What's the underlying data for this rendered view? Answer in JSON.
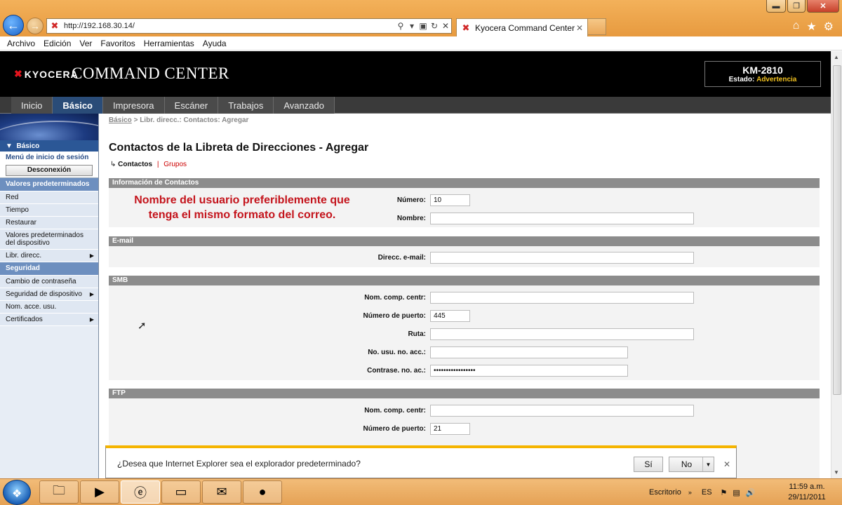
{
  "browser": {
    "url": "http://192.168.30.14/",
    "tab_title": "Kyocera Command Center",
    "menu": [
      "Archivo",
      "Edición",
      "Ver",
      "Favoritos",
      "Herramientas",
      "Ayuda"
    ]
  },
  "header": {
    "brand": "KYOCERA",
    "title": "COMMAND CENTER",
    "model": "KM-2810",
    "status_label": "Estado:",
    "status_value": "Advertencia"
  },
  "nav": [
    "Inicio",
    "Básico",
    "Impresora",
    "Escáner",
    "Trabajos",
    "Avanzado"
  ],
  "sidebar": {
    "basic": "Básico",
    "session_menu": "Menú de inicio de sesión",
    "logout": "Desconexión",
    "items": [
      {
        "label": "Valores predeterminados",
        "type": "section"
      },
      {
        "label": "Red",
        "type": "item"
      },
      {
        "label": "Tiempo",
        "type": "item"
      },
      {
        "label": "Restaurar",
        "type": "item"
      },
      {
        "label": "Valores predeterminados del dispositivo",
        "type": "item"
      },
      {
        "label": "Libr. direcc.",
        "type": "item",
        "arrow": true
      },
      {
        "label": "Seguridad",
        "type": "section"
      },
      {
        "label": "Cambio de contraseña",
        "type": "item"
      },
      {
        "label": "Seguridad de dispositivo",
        "type": "item",
        "arrow": true
      },
      {
        "label": "Nom. acce. usu.",
        "type": "item"
      },
      {
        "label": "Certificados",
        "type": "item",
        "arrow": true
      }
    ]
  },
  "breadcrumb": {
    "link": "Básico",
    "sep": ">",
    "current": "Libr. direcc.: Contactos: Agregar"
  },
  "page": {
    "title": "Contactos de la Libreta de Direcciones - Agregar",
    "subnav_current": "Contactos",
    "subnav_sep": "|",
    "subnav_other": "Grupos",
    "note": "Nombre del usuario preferiblemente que tenga el mismo formato del correo."
  },
  "form": {
    "contact_section": "Información de Contactos",
    "number_label": "Número:",
    "number_value": "10",
    "name_label": "Nombre:",
    "name_value": "",
    "email_section": "E-mail",
    "email_label": "Direcc. e-mail:",
    "email_value": "",
    "smb_section": "SMB",
    "smb_host_label": "Nom. comp. centr:",
    "smb_host_value": "",
    "smb_port_label": "Número de puerto:",
    "smb_port_value": "445",
    "smb_path_label": "Ruta:",
    "smb_path_value": "",
    "smb_user_label": "No. usu. no. acc.:",
    "smb_user_value": "",
    "smb_pass_label": "Contrase. no. ac.:",
    "smb_pass_value": "•••••••••••••••••",
    "ftp_section": "FTP",
    "ftp_host_label": "Nom. comp. centr:",
    "ftp_host_value": "",
    "ftp_port_label": "Número de puerto:",
    "ftp_port_value": "21"
  },
  "infobar": {
    "message": "¿Desea que Internet Explorer sea el explorador predeterminado?",
    "yes": "Sí",
    "no": "No"
  },
  "taskbar": {
    "desktop": "Escritorio",
    "lang": "ES",
    "time": "11:59 a.m.",
    "date": "29/11/2011"
  }
}
